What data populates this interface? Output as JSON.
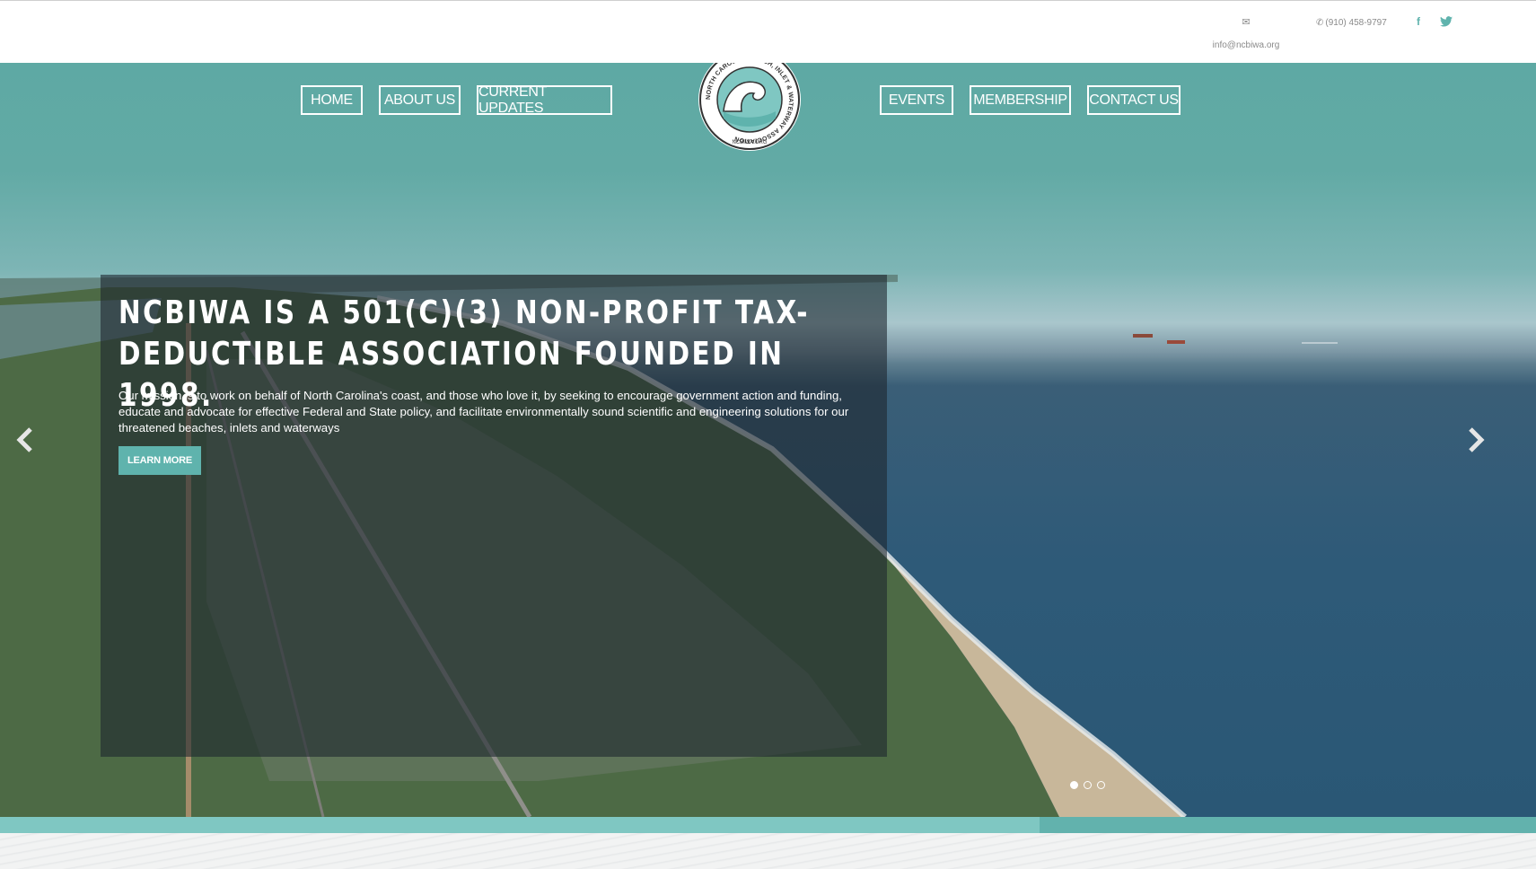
{
  "contact": {
    "email_icon": "envelope-icon",
    "email": "info@ncbiwa.org",
    "phone_icon": "phone-icon",
    "phone": "(910) 458-9797",
    "facebook_icon": "facebook-icon",
    "facebook_glyph": "f",
    "twitter_icon": "twitter-icon"
  },
  "nav": {
    "left": [
      {
        "label": "HOME"
      },
      {
        "label": "ABOUT US"
      },
      {
        "label": "CURRENT UPDATES"
      }
    ],
    "right": [
      {
        "label": "EVENTS"
      },
      {
        "label": "MEMBERSHIP"
      },
      {
        "label": "CONTACT US"
      }
    ]
  },
  "logo": {
    "ring_text": "NORTH CAROLINA BEACH, INLET & WATERWAY ASSOCIATION",
    "bottom_text": "NCBIWA.ORG"
  },
  "hero": {
    "headline": "NCBIWA IS A 501(C)(3) NON-PROFIT TAX-DEDUCTIBLE ASSOCIATION FOUNDED IN 1998.",
    "body": "Our mission is to work on behalf of North Carolina's coast, and those who love it, by seeking to encourage government action and funding, educate and advocate for effective Federal and State policy, and facilitate environmentally sound scientific and engineering solutions for our threatened beaches, inlets and waterways",
    "cta_label": "LEARN MORE",
    "slides_total": 3,
    "active_slide": 1,
    "progress_fraction": 0.677
  },
  "colors": {
    "brand_teal": "#5fb3ad",
    "caption_overlay": "rgba(30,38,46,0.6)",
    "icon_gray": "#8a8a8a"
  }
}
